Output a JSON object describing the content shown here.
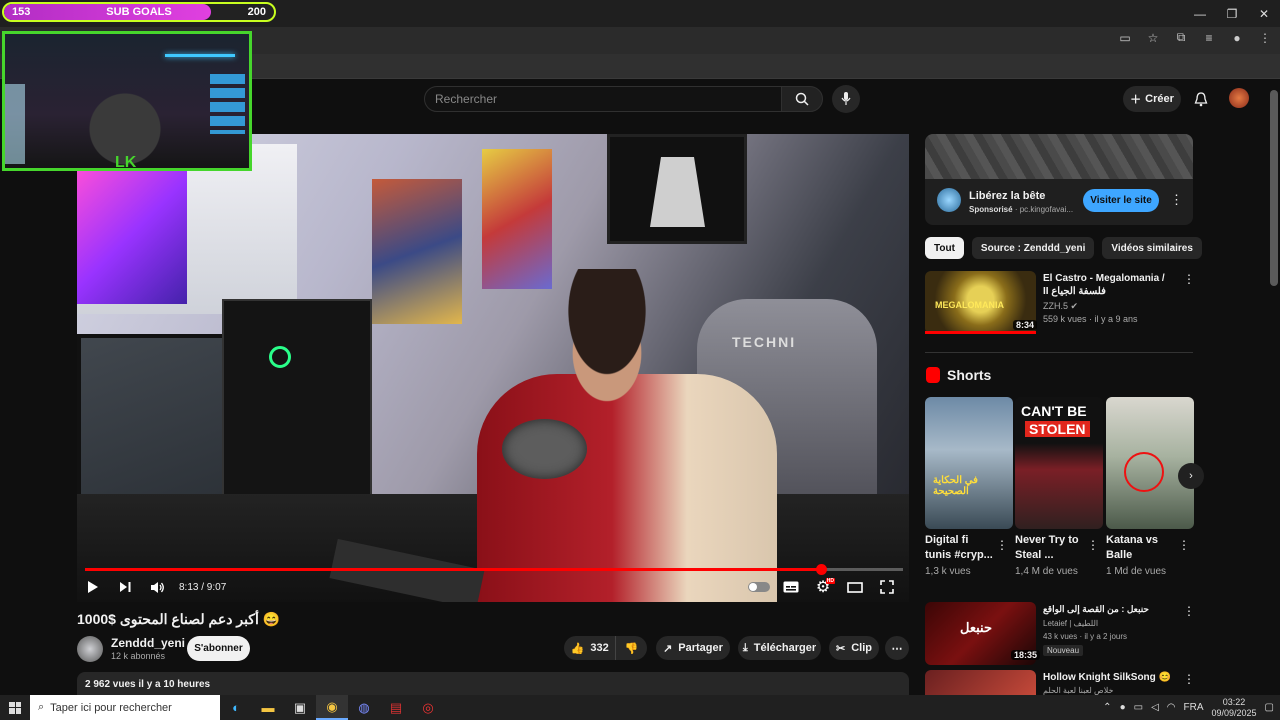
{
  "overlay": {
    "sub_goals": {
      "current": "153",
      "title": "SUB GOALS",
      "target": "200",
      "progress": 0.765,
      "fill_color": "#d63cd8",
      "border_color": "#c8ff1f"
    },
    "webcam_logo": "LK"
  },
  "browser": {
    "window_controls": [
      "—",
      "❐",
      "✕"
    ]
  },
  "header": {
    "search_placeholder": "Rechercher",
    "create_label": "Créer"
  },
  "player": {
    "chair_brand": "TECHNI",
    "time": "8:13 / 9:07",
    "progress": 0.9,
    "accent": "#ff0000"
  },
  "video": {
    "title": "1000$ أكبر دعم لصناع المحتوى 😄",
    "channel": "Zenddd_yeni",
    "subscribers": "12 k abonnés",
    "subscribe_label": "S'abonner",
    "likes": "332",
    "share_label": "Partager",
    "download_label": "Télécharger",
    "clip_label": "Clip",
    "description_meta": "2 962 vues  il y a 10 heures"
  },
  "sidebar": {
    "ad": {
      "title": "Libérez la bête",
      "sponsored": "Sponsorisé",
      "domain": "· pc.kingofavai...",
      "cta": "Visiter le site"
    },
    "chips": [
      "Tout",
      "Source : Zenddd_yeni",
      "Vidéos similaires"
    ],
    "rec1": {
      "thumb_label": "MEGALOMANIA",
      "duration": "8:34",
      "title": "El Castro - Megalomania / II فلسفة الجياع",
      "channel": "ZZH.5 ✔",
      "meta": "559 k vues · il y a 9 ans"
    },
    "shorts_title": "Shorts",
    "shorts": [
      {
        "thumb_text": "في الحكاية الصحيحة",
        "title": "Digital fi tunis #cryp...",
        "views": "1,3 k vues"
      },
      {
        "thumb_text_1": "CAN'T BE",
        "thumb_text_2": "STOLEN",
        "title": "Never Try to Steal ...",
        "views": "1,4 M de vues"
      },
      {
        "title": "Katana vs Balle",
        "views": "1 Md de vues"
      }
    ],
    "rec2": {
      "thumb_text": "حنبعل",
      "duration": "18:35",
      "title": "حنبعل : من القصة إلى الواقع",
      "channel": "Letaief | اللطيف",
      "meta": "43 k vues · il y a 2 jours",
      "badge": "Nouveau"
    },
    "rec3": {
      "title": "Hollow Knight SilkSong 😊",
      "subtitle": "خلاص لعبنا لعبة الحلم"
    }
  },
  "taskbar": {
    "search_placeholder": "Taper ici pour rechercher",
    "language": "FRA",
    "time": "03:22",
    "date": "09/09/2025"
  }
}
